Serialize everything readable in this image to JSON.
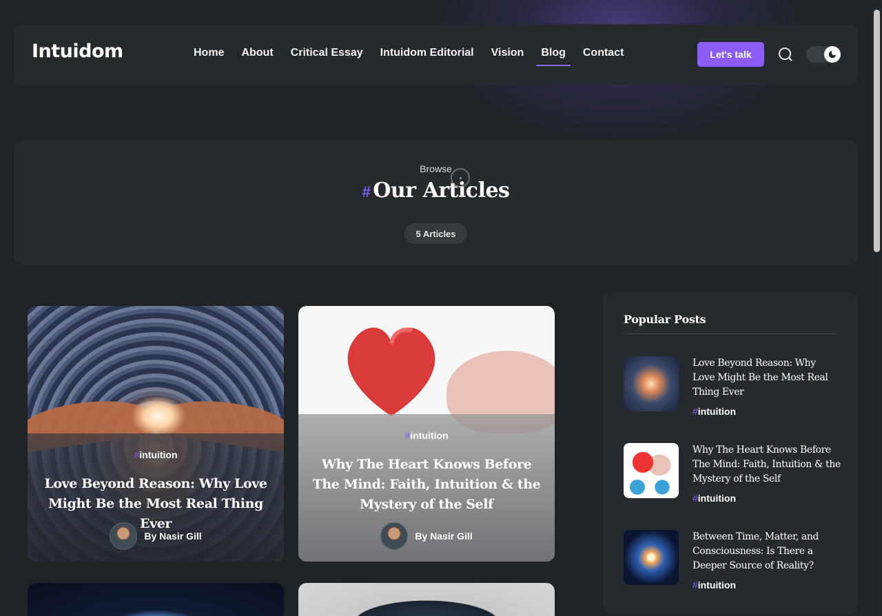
{
  "header": {
    "logo": "Intuidom",
    "nav": [
      {
        "label": "Home",
        "active": false
      },
      {
        "label": "About",
        "active": false
      },
      {
        "label": "Critical Essay",
        "active": false
      },
      {
        "label": "Intuidom Editorial",
        "active": false
      },
      {
        "label": "Vision",
        "active": false
      },
      {
        "label": "Blog",
        "active": true
      },
      {
        "label": "Contact",
        "active": false
      }
    ],
    "cta_label": "Let's talk",
    "search_icon": "search-icon",
    "theme_toggle_icon": "moon-icon",
    "accent_color": "#8b5cf6"
  },
  "hero": {
    "eyebrow": "Browse",
    "hash": "#",
    "title": "Our Articles",
    "count_badge": "5 Articles"
  },
  "articles": [
    {
      "tag_hash": "#",
      "tag": "intuition",
      "title": "Love Beyond Reason: Why Love Might Be the Most Real Thing Ever",
      "author": "By Nasir Gill"
    },
    {
      "tag_hash": "#",
      "tag": "intuition",
      "title": "Why The Heart Knows Before The Mind: Faith, Intuition & the Mystery of the Self",
      "author": "By Nasir Gill"
    }
  ],
  "sidebar": {
    "title": "Popular Posts",
    "posts": [
      {
        "title": "Love Beyond Reason: Why Love Might Be the Most Real Thing Ever",
        "tag_hash": "#",
        "tag": "intuition"
      },
      {
        "title": "Why The Heart Knows Before The Mind: Faith, Intuition & the Mystery of the Self",
        "tag_hash": "#",
        "tag": "intuition"
      },
      {
        "title": "Between Time, Matter, and Consciousness: Is There a Deeper Source of Reality?",
        "tag_hash": "#",
        "tag": "intuition"
      }
    ]
  }
}
